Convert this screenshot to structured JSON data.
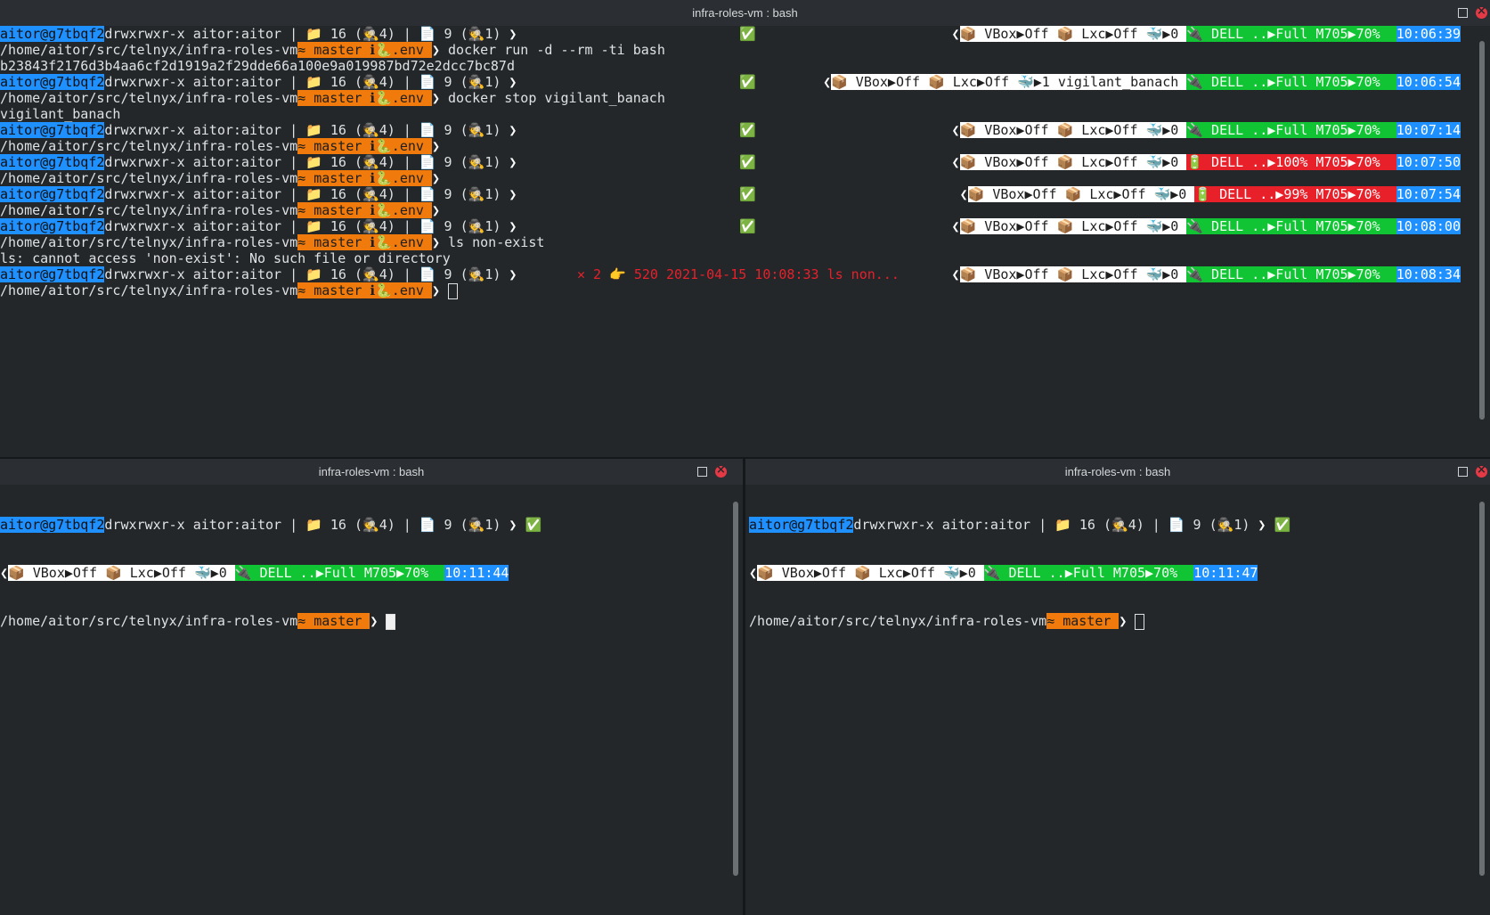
{
  "top_pane": {
    "title": "infra-roles-vm : bash",
    "prompt": {
      "user": "aitor@g7tbqf2",
      "perms": "drwxrwxr-x aitor:aitor",
      "dirs": " | 📁 16 (🕵4) | 📄 9 (🕵1) ",
      "path": "/home/aitor/src/telnyx/infra-roles-vm",
      "git": "≈ master ℹ🐍.env ",
      "status_ok": "✅"
    },
    "lines": [
      {
        "kind": "header",
        "vbox": "📦 VBox▶Off",
        "lxc": "📦 Lxc▶Off",
        "docker": "🐳▶0",
        "power": "🔌 DELL ..▶Full M705▶70%",
        "power_state": "full",
        "time": "10:06:39"
      },
      {
        "kind": "cmd",
        "text": " docker run -d --rm -ti bash"
      },
      {
        "kind": "out",
        "text": "b23843f2176d3b4aa6cf2d1919a2f29dde66a100e9a019987bd72e2dcc7bc87d"
      },
      {
        "kind": "header",
        "vbox": "📦 VBox▶Off",
        "lxc": "📦 Lxc▶Off",
        "docker": "🐳▶1 vigilant_banach",
        "power": "🔌 DELL ..▶Full M705▶70%",
        "power_state": "full",
        "time": "10:06:54"
      },
      {
        "kind": "cmd",
        "text": " docker stop vigilant_banach"
      },
      {
        "kind": "out",
        "text": "vigilant_banach"
      },
      {
        "kind": "header",
        "vbox": "📦 VBox▶Off",
        "lxc": "📦 Lxc▶Off",
        "docker": "🐳▶0",
        "power": "🔌 DELL ..▶Full M705▶70%",
        "power_state": "full",
        "time": "10:07:14"
      },
      {
        "kind": "cmd",
        "text": ""
      },
      {
        "kind": "header",
        "vbox": "📦 VBox▶Off",
        "lxc": "📦 Lxc▶Off",
        "docker": "🐳▶0",
        "power": "🔋 DELL ..▶100% M705▶70%",
        "power_state": "low",
        "time": "10:07:50"
      },
      {
        "kind": "cmd",
        "text": ""
      },
      {
        "kind": "header",
        "vbox": "📦 VBox▶Off",
        "lxc": "📦 Lxc▶Off",
        "docker": "🐳▶0",
        "power": "🔋 DELL ..▶99% M705▶70%",
        "power_state": "low",
        "time": "10:07:54"
      },
      {
        "kind": "cmd",
        "text": ""
      },
      {
        "kind": "header",
        "vbox": "📦 VBox▶Off",
        "lxc": "📦 Lxc▶Off",
        "docker": "🐳▶0",
        "power": "🔌 DELL ..▶Full M705▶70%",
        "power_state": "full",
        "time": "10:08:00"
      },
      {
        "kind": "cmd",
        "text": " ls non-exist"
      },
      {
        "kind": "out",
        "text": "ls: cannot access 'non-exist': No such file or directory"
      },
      {
        "kind": "header_err",
        "error": "✕ 2 👉 520 2021-04-15 10:08:33 ls non...",
        "vbox": "📦 VBox▶Off",
        "lxc": "📦 Lxc▶Off",
        "docker": "🐳▶0",
        "power": "🔌 DELL ..▶Full M705▶70%",
        "power_state": "full",
        "time": "10:08:34"
      },
      {
        "kind": "cmd_cursor",
        "text": " "
      }
    ]
  },
  "bottom_left": {
    "title": "infra-roles-vm : bash",
    "user": "aitor@g7tbqf2",
    "perms": "drwxrwxr-x aitor:aitor",
    "dirs": " | 📁 16 (🕵4) | 📄 9 (🕵1) ",
    "status_ok": "✅",
    "vbox": "📦 VBox▶Off",
    "lxc": "📦 Lxc▶Off",
    "docker": "🐳▶0",
    "power": "🔌 DELL ..▶Full M705▶70%",
    "time": "10:11:44",
    "path": "/home/aitor/src/telnyx/infra-roles-vm",
    "git": "≈ master "
  },
  "bottom_right": {
    "title": "infra-roles-vm : bash",
    "user": "aitor@g7tbqf2",
    "perms": "drwxrwxr-x aitor:aitor",
    "dirs": " | 📁 16 (🕵4) | 📄 9 (🕵1) ",
    "status_ok": "✅",
    "vbox": "📦 VBox▶Off",
    "lxc": "📦 Lxc▶Off",
    "docker": "🐳▶0",
    "power": "🔌 DELL ..▶Full M705▶70%",
    "time": "10:11:47",
    "path": "/home/aitor/src/telnyx/infra-roles-vm",
    "git": "≈ master "
  },
  "colors": {
    "background": "#23272a",
    "user_bg": "#1e90ff",
    "git_bg": "#f07b0c",
    "power_full_bg": "#11c434",
    "power_low_bg": "#e8202a",
    "error_fg": "#e8202a"
  }
}
